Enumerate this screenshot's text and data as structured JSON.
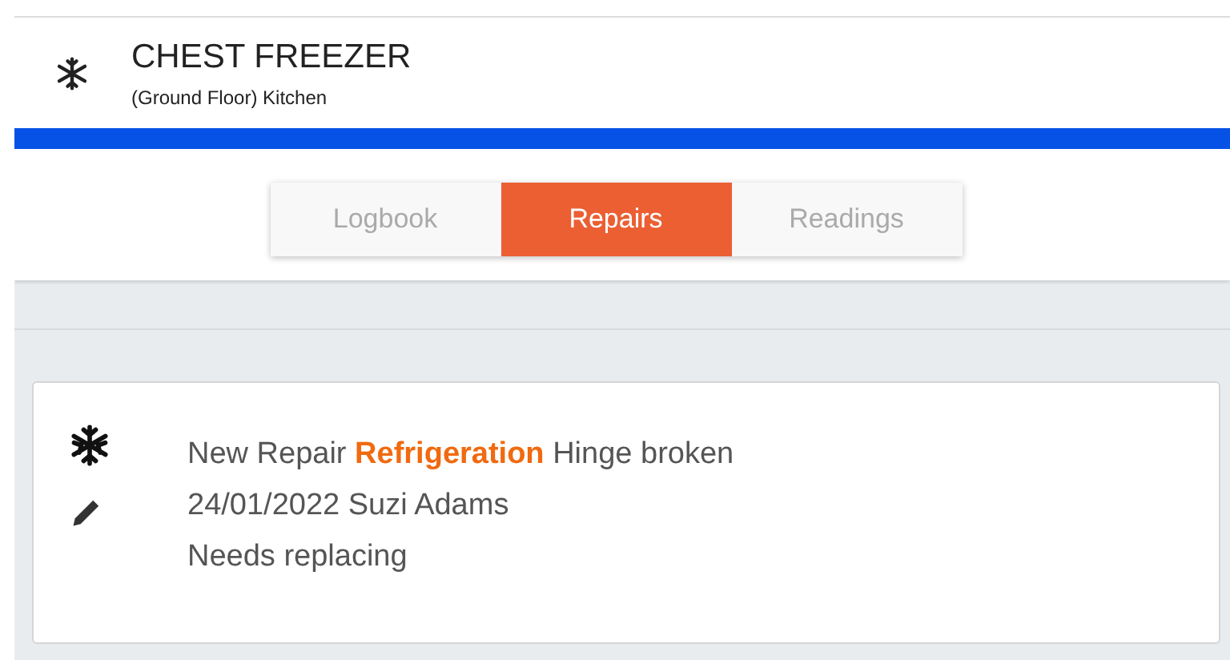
{
  "header": {
    "title": "CHEST FREEZER",
    "subtitle": "(Ground Floor) Kitchen"
  },
  "tabs": [
    {
      "label": "Logbook",
      "selected": false
    },
    {
      "label": "Repairs",
      "selected": true
    },
    {
      "label": "Readings",
      "selected": false
    }
  ],
  "repairs": [
    {
      "summary": "New Repair **Refrigeration** Hinge broken",
      "meta": "24/01/2022 Suzi Adams",
      "note": "Needs replacing"
    }
  ]
}
